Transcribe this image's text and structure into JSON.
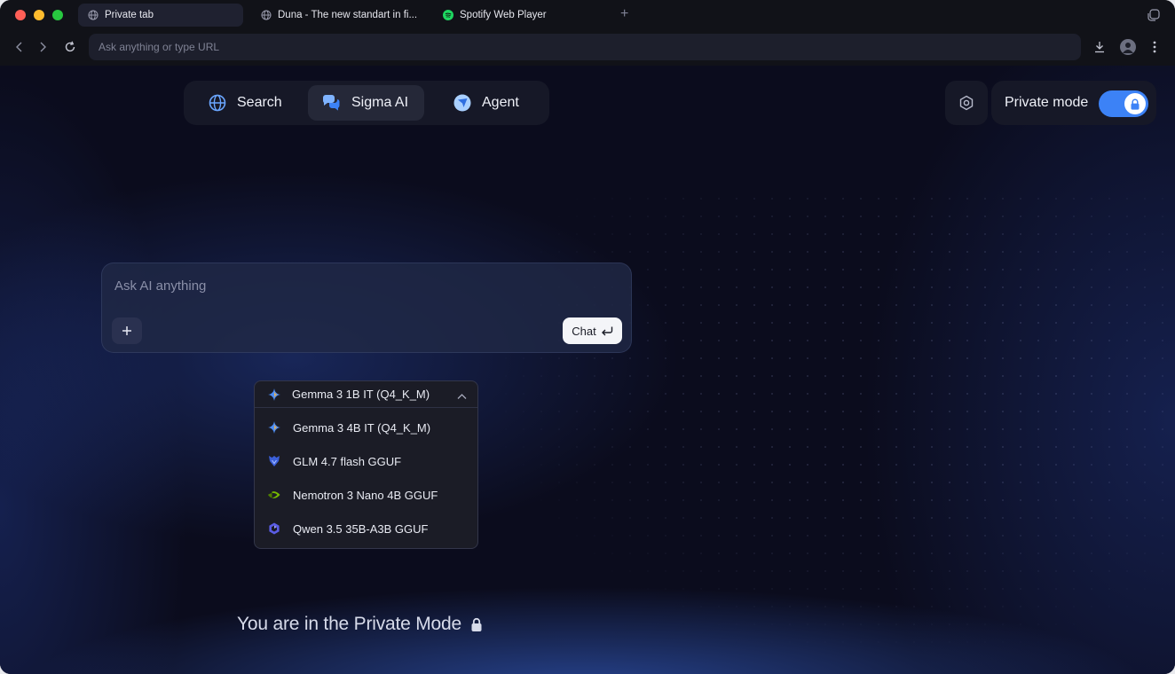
{
  "tabs": [
    {
      "title": "Private tab",
      "icon": "globe-icon",
      "active": true
    },
    {
      "title": "Duna - The new standart in fi...",
      "icon": "globe-icon",
      "active": false
    },
    {
      "title": "Spotify Web Player",
      "icon": "spotify-icon",
      "active": false
    }
  ],
  "address_bar": {
    "placeholder": "Ask anything or type URL"
  },
  "modes": [
    {
      "label": "Search",
      "icon": "globe-icon"
    },
    {
      "label": "Sigma AI",
      "icon": "chat-bubbles-icon",
      "active": true
    },
    {
      "label": "Agent",
      "icon": "agent-icon"
    }
  ],
  "private_mode": {
    "label": "Private mode",
    "enabled": true
  },
  "ask_box": {
    "placeholder": "Ask AI anything",
    "chat_label": "Chat"
  },
  "model_picker": {
    "selected": "Gemma 3 1B IT (Q4_K_M)",
    "options": [
      {
        "label": "Gemma 3 4B IT (Q4_K_M)",
        "icon": "gemma-icon"
      },
      {
        "label": "GLM 4.7 flash GGUF",
        "icon": "glm-icon"
      },
      {
        "label": "Nemotron 3 Nano 4B GGUF",
        "icon": "nvidia-icon"
      },
      {
        "label": "Qwen 3.5 35B-A3B GGUF",
        "icon": "qwen-icon"
      }
    ]
  },
  "footer": {
    "message": "You are in the Private Mode"
  },
  "colors": {
    "accent": "#3c82f6",
    "background": "#0b0c1d",
    "glow": "#3c6ee6"
  }
}
